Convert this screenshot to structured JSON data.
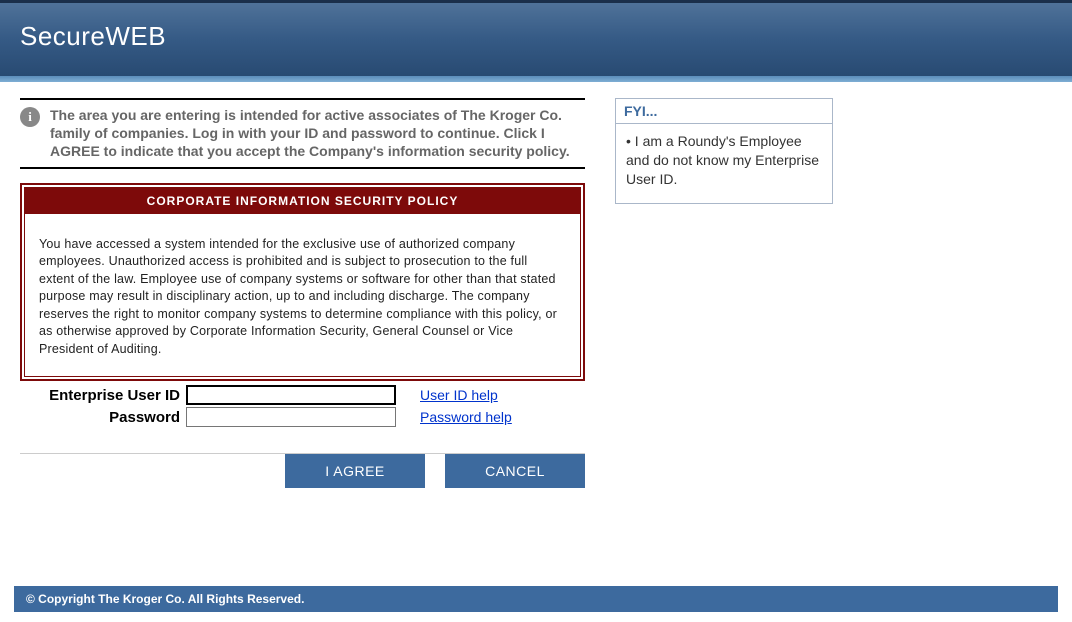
{
  "header": {
    "title": "SecureWEB"
  },
  "notice": {
    "icon": "i",
    "text": "The area you are entering is intended for active associates of The Kroger Co. family of companies.  Log in with your ID and password to continue.  Click I AGREE to indicate that you accept the Company's information security policy."
  },
  "policy": {
    "title": "CORPORATE INFORMATION SECURITY POLICY",
    "body": "You have accessed a system intended for the exclusive use of authorized company employees.  Unauthorized access is prohibited and is subject to prosecution to the full extent of the law.  Employee use of company systems or software for other than that stated purpose may result in disciplinary action, up to and including discharge.  The company reserves the right to monitor company systems to determine compliance with this policy, or as otherwise approved by Corporate Information Security, General Counsel or Vice President of Auditing."
  },
  "form": {
    "user_label": "Enterprise User ID",
    "user_value": "",
    "user_help": "User ID help",
    "password_label": "Password",
    "password_value": "",
    "password_help": "Password help"
  },
  "buttons": {
    "agree": "I AGREE",
    "cancel": "CANCEL"
  },
  "fyi": {
    "title": "FYI...",
    "items": [
      "I am a Roundy's Employee and do not know my Enterprise User ID."
    ]
  },
  "footer": {
    "copyright": "© Copyright The Kroger Co. All Rights Reserved."
  }
}
